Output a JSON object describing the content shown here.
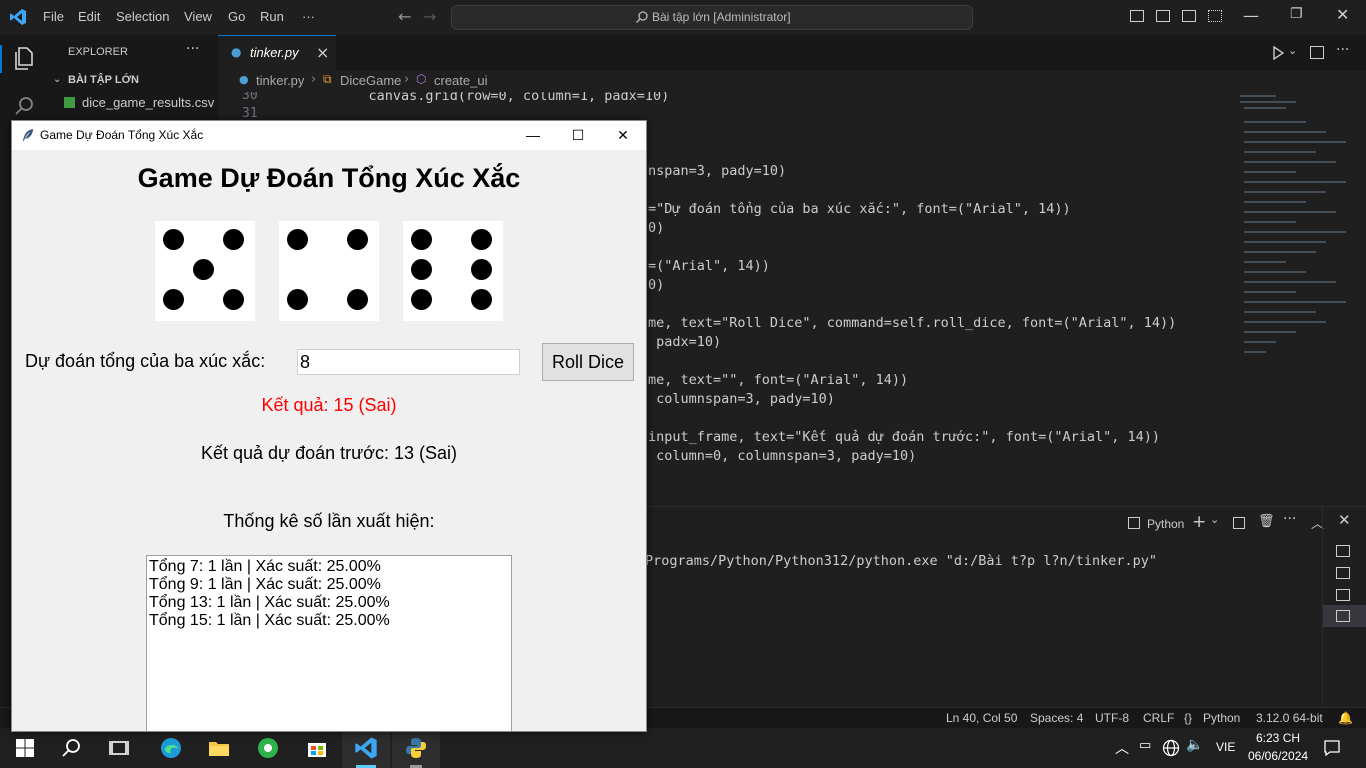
{
  "vscode": {
    "menu": [
      "File",
      "Edit",
      "Selection",
      "View",
      "Go",
      "Run",
      "···"
    ],
    "command_center": "Bài tập lớn [Administrator]",
    "explorer": {
      "header": "EXPLORER",
      "folder": "BÀI TẬP LỚN",
      "files": [
        "dice_game_results.csv"
      ]
    },
    "tab": {
      "label": "tinker.py",
      "close": "×"
    },
    "breadcrumb": [
      "tinker.py",
      "DiceGame",
      "create_ui"
    ],
    "line_numbers": [
      "30",
      "31"
    ],
    "code_lines": [
      "    canvas.grid(row=0, column=1, padx=10)",
      "nspan=3, pady=10)",
      "=\"Dự đoán tổng của ba xúc xắc:\", font=(\"Arial\", 14))",
      "0)",
      "=(\"Arial\", 14))",
      "0)",
      "me, text=\"Roll Dice\", command=self.roll_dice, font=(\"Arial\", 14))",
      " padx=10)",
      "me, text=\"\", font=(\"Arial\", 14))",
      " columnspan=3, pady=10)",
      "input_frame, text=\"Kết quả dự đoán trước:\", font=(\"Arial\", 14))",
      " column=0, columnspan=3, pady=10)"
    ],
    "panel": {
      "terminal_label": "Python",
      "terminal_line": "Programs/Python/Python312/python.exe \"d:/Bài t?p l?n/tinker.py\""
    },
    "status": {
      "position": "Ln 40, Col 50",
      "spaces": "Spaces: 4",
      "encoding": "UTF-8",
      "eol": "CRLF",
      "language": "Python",
      "interpreter": "3.12.0 64-bit"
    }
  },
  "taskbar": {
    "lang": "VIE",
    "time": "6:23 CH",
    "date": "06/06/2024"
  },
  "tk": {
    "window_title": "Game Dự Đoán Tổng Xúc Xắc",
    "heading": "Game Dự Đoán Tổng Xúc Xắc",
    "dice": [
      5,
      4,
      6
    ],
    "guess_label": "Dự đoán tổng của ba xúc xắc:",
    "guess_value": "8",
    "roll_button": "Roll Dice",
    "result": "Kết quả: 15 (Sai)",
    "result_color": "#ff0000",
    "previous": "Kết quả dự đoán trước: 13 (Sai)",
    "stats_title": "Thống kê số lần xuất hiện:",
    "stats": [
      "Tổng 7: 1 lần | Xác suất: 25.00%",
      "Tổng 9: 1 lần | Xác suất: 25.00%",
      "Tổng 13: 1 lần | Xác suất: 25.00%",
      "Tổng 15: 1 lần | Xác suất: 25.00%"
    ]
  }
}
